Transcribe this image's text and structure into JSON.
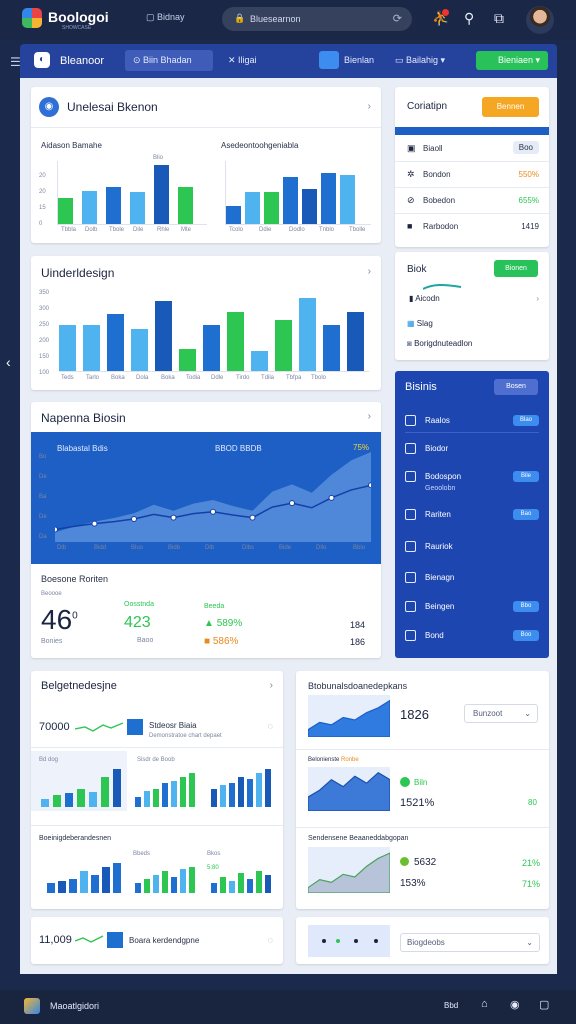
{
  "topbar": {
    "brand": "Boologoi",
    "brand_sub": "SHOWCASE",
    "chip": "Bidnay",
    "search_value": "Bluesearnon",
    "bell": "🔔"
  },
  "appbar": {
    "title": "Bleanoor",
    "tab": "Biin Bhadan",
    "item2": "Iligai",
    "item3": "Bienlan",
    "item4": "Bailahig",
    "btn": "Bieniaen"
  },
  "card1": {
    "title": "Unelesai Bkenon",
    "left_label": "Aidason Bamahe",
    "right_label": "Asedeontoohgeniabla",
    "ticks_left": [
      "Tbbla",
      "Dolb",
      "Tbole",
      "Dile",
      "Rhle",
      "Mte"
    ],
    "ticks_right": [
      "Tcolo",
      "Ddie",
      "Dodlo",
      "Tnblo",
      "Tbolle"
    ],
    "y_left": [
      "20",
      "20",
      "15",
      "0"
    ],
    "bar_label": "Blio",
    "chart_data": {
      "type": "bar",
      "series": [
        {
          "name": "left",
          "values": [
            26,
            34,
            38,
            33,
            60,
            38
          ]
        },
        {
          "name": "right",
          "values": [
            18,
            32,
            32,
            48,
            36,
            52,
            50
          ]
        }
      ]
    }
  },
  "card2": {
    "title": "Uinderldesign",
    "y": [
      "350",
      "300",
      "250",
      "200",
      "150",
      "100"
    ],
    "ticks": [
      "Teds",
      "Tarlo",
      "Boka",
      "Dola",
      "Boka",
      "Todia",
      "Ddle",
      "Tirdo",
      "Tdila",
      "Tbfpa",
      "Tbolo"
    ],
    "chart_data": {
      "type": "bar",
      "values": [
        42,
        42,
        52,
        38,
        64,
        20,
        42,
        54,
        18,
        46,
        66,
        42,
        54
      ]
    }
  },
  "card3": {
    "title": "Napenna Biosin",
    "inner_title": "Blabastal Bdis",
    "inner_mid": "BBOD BBDB",
    "inner_val": "75%",
    "y": [
      "Bo",
      "De",
      "Ba",
      "De",
      "Da"
    ],
    "ticks": [
      "Dlb",
      "Bidd",
      "Bluo",
      "Bidb",
      "Dlb",
      "Dlbs",
      "Bide",
      "Dllo",
      "Bblo"
    ],
    "chart_data": {
      "type": "area",
      "values": [
        8,
        13,
        17,
        20,
        24,
        31,
        26,
        32,
        35,
        30,
        26,
        42,
        48,
        41,
        56,
        68,
        75
      ]
    },
    "metric_title": "Boesone Roriten",
    "metric_sub": "Beoooe",
    "big": "46",
    "big_sup": "0",
    "big_sub": "Bonies",
    "m2_label": "Oosstnda",
    "m2_val": "423",
    "m2_sub": "Baoo",
    "m3_label": "Beeda",
    "m3_pct": "589%",
    "m3_pct2": "586%",
    "m4": "184",
    "m5": "186"
  },
  "side1": {
    "title": "Coriatipn",
    "btn": "Bennen",
    "rows": [
      {
        "label": "Biaoll",
        "val": "Boo"
      },
      {
        "label": "Bondon",
        "val": "550%"
      },
      {
        "label": "Bobedon",
        "val": "655%"
      },
      {
        "label": "Rarbodon",
        "val": "1419"
      }
    ]
  },
  "side2": {
    "title": "Biok",
    "btn": "Bionen",
    "rows": [
      {
        "label": "Aicodn"
      },
      {
        "label": "Slag"
      },
      {
        "label": "Borigdnuteadlon"
      }
    ]
  },
  "bluepanel": {
    "title": "Bisinis",
    "btn": "Bosen",
    "items": [
      {
        "label": "Raalos",
        "tag": "Blao"
      },
      {
        "label": "Biodor",
        "tag": ""
      },
      {
        "label": "Bodospon",
        "sub": "Geoolobn",
        "tag": "Bile"
      },
      {
        "label": "Rariten",
        "tag": "Bao"
      },
      {
        "label": "Rauriok",
        "tag": ""
      },
      {
        "label": "Bienagn",
        "tag": ""
      },
      {
        "label": "Beingen",
        "tag": "Bbo"
      },
      {
        "label": "Bond",
        "tag": "Boo"
      }
    ]
  },
  "card4": {
    "title": "Belgetnedesjne",
    "metric": "70000",
    "metric_label": "Stdeosr Biaia",
    "metric_sub": "Demonstratoe chart depaet",
    "mini1_title": "Bd dog",
    "mini2_title": "Sisdr de Boob",
    "mini3_title": "Boeinigdeberandesnen",
    "mini4_title": "Bbeds",
    "mini5_title": "Bkos",
    "mini5_val": "5:80",
    "bottom_val": "11,009",
    "bottom_label": "Boara kerdendgpne",
    "chart_data": {
      "type": "bar",
      "series": [
        {
          "name": "m1",
          "values": [
            8,
            12,
            14,
            18,
            15,
            30,
            38
          ]
        },
        {
          "name": "m2",
          "values": [
            10,
            16,
            18,
            24,
            26,
            30,
            34
          ]
        },
        {
          "name": "m3",
          "values": [
            18,
            22,
            24,
            30,
            28,
            34,
            38
          ]
        },
        {
          "name": "m4",
          "values": [
            10,
            12,
            14,
            22,
            18,
            26,
            30
          ]
        },
        {
          "name": "m5",
          "values": [
            10,
            14,
            18,
            22,
            16,
            24,
            26
          ]
        }
      ]
    }
  },
  "card5": {
    "title": "Btobunalsdoanedepkans",
    "val1": "1826",
    "select1": "Bunzoot",
    "r2_title": "Belonienste",
    "r2_tag": "Ronbe",
    "r2_label": "Biln",
    "r2_val": "1521%",
    "r2_right": "80",
    "r3_title": "Sendensene Beaaneddabgopan",
    "r3_a": "5632",
    "r3_a_pct": "21%",
    "r3_b": "153%",
    "r3_b_pct": "71%",
    "select2": "Biogdeobs",
    "chart_data": {
      "type": "area",
      "series": [
        {
          "name": "c1",
          "values": [
            6,
            12,
            10,
            16,
            14,
            20,
            24,
            30
          ]
        },
        {
          "name": "c2",
          "values": [
            8,
            12,
            18,
            14,
            20,
            16,
            22,
            18
          ]
        },
        {
          "name": "c3",
          "values": [
            4,
            10,
            8,
            14,
            12,
            20,
            26,
            30
          ]
        }
      ]
    }
  },
  "bottombar": {
    "label": "Maoatlgidori",
    "i1": "Bbd"
  }
}
